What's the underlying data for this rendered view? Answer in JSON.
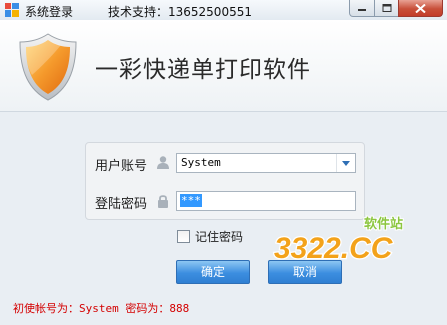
{
  "window": {
    "title": "系统登录",
    "support": "技术支持：13652500551",
    "controls": {
      "minimize": "minimize",
      "maximize": "maximize",
      "close": "close"
    }
  },
  "header": {
    "app_name": "一彩快递单打印软件",
    "logo_icon": "shield-icon"
  },
  "form": {
    "username_label": "用户账号",
    "username_value": "System",
    "username_icon": "user-icon",
    "password_label": "登陆密码",
    "password_mask": "***",
    "password_icon": "lock-icon",
    "remember_label": "记住密码",
    "remember_checked": false
  },
  "buttons": {
    "ok": "确定",
    "cancel": "取消"
  },
  "hint": "初使帐号为：System 密码为：888",
  "watermark": {
    "main": "3322.CC",
    "side": "软件站"
  },
  "colors": {
    "accent": "#3c8ee0",
    "hint": "#d40000",
    "close_button": "#c8503a",
    "shield": "#f0902a"
  }
}
